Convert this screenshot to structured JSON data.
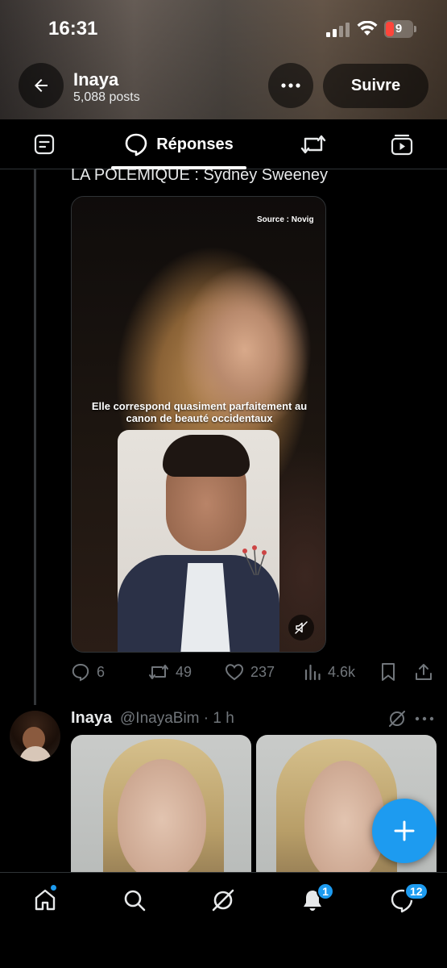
{
  "status_bar": {
    "time": "16:31",
    "battery": "9"
  },
  "profile": {
    "name": "Inaya",
    "posts": "5,088 posts",
    "follow_label": "Suivre"
  },
  "tabs": {
    "active_label": "Réponses"
  },
  "tweet1": {
    "text": "LA POLEMIQUE : Sydney Sweeney",
    "video_source": "Source : Novig",
    "video_caption": "Elle correspond quasiment parfaitement au canon de beauté occidentaux",
    "replies": "6",
    "retweets": "49",
    "likes": "237",
    "views": "4.6k"
  },
  "tweet2": {
    "name": "Inaya",
    "meta": "@InayaBim · 1 h"
  },
  "bottom_nav": {
    "notifications_badge": "1",
    "messages_badge": "12"
  },
  "colors": {
    "accent": "#1d9bf0",
    "muted": "#71767b",
    "text": "#e7e9ea",
    "battery_low": "#ff453a"
  },
  "icons": [
    "back-arrow-icon",
    "more-icon",
    "posts-tab-icon",
    "replies-icon",
    "repost-icon",
    "media-tab-icon",
    "mute-icon",
    "reply-icon",
    "like-icon",
    "views-icon",
    "bookmark-icon",
    "share-icon",
    "grok-icon",
    "plus-icon",
    "home-icon",
    "search-icon",
    "bell-icon",
    "messages-icon"
  ]
}
